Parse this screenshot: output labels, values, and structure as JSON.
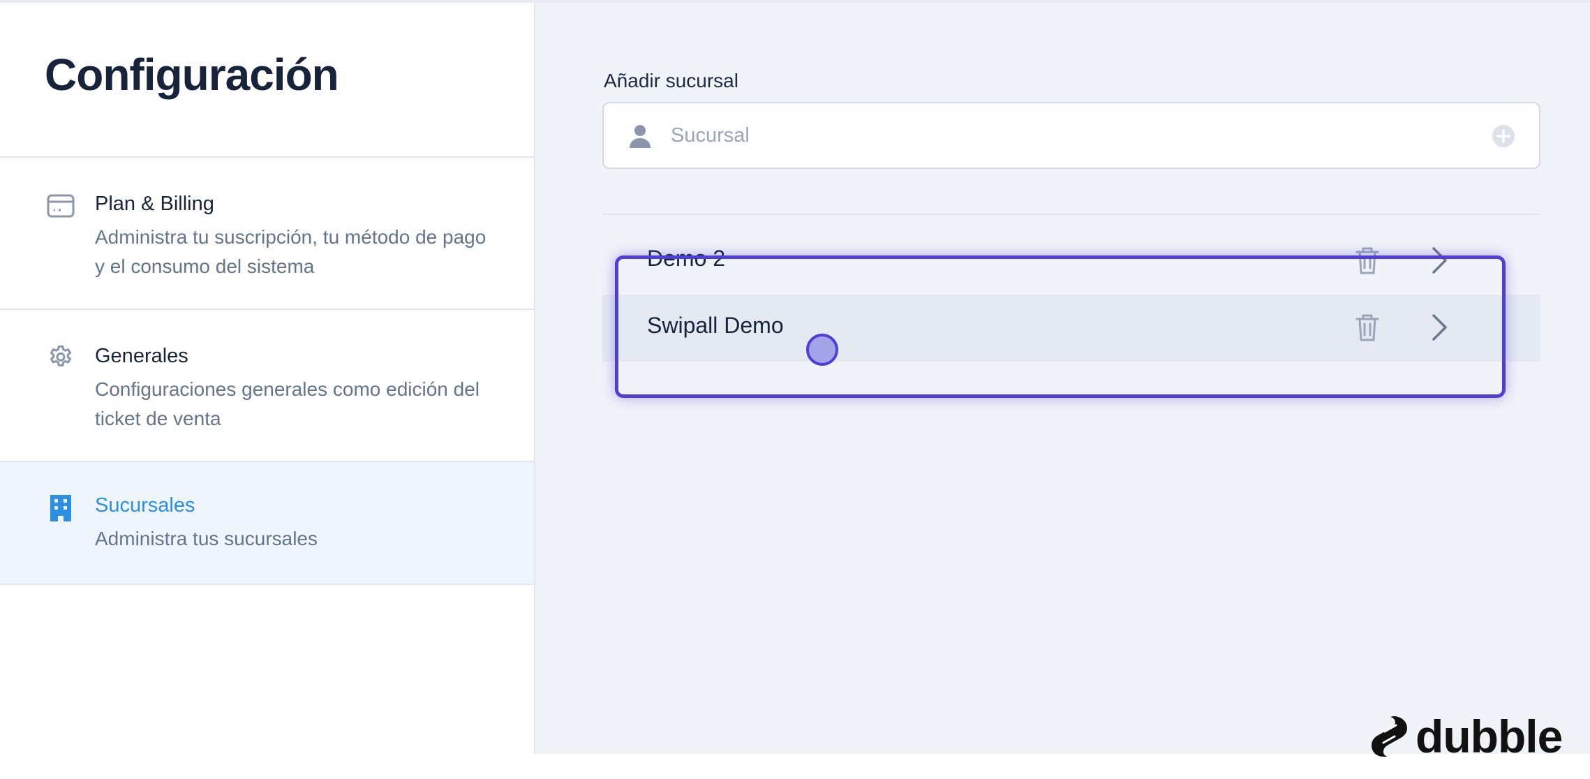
{
  "sidebar": {
    "title": "Configuración",
    "items": [
      {
        "icon": "credit-card-icon",
        "title": "Plan & Billing",
        "description": "Administra tu suscripción, tu método de pago y el consumo del sistema",
        "active": false
      },
      {
        "icon": "gear-icon",
        "title": "Generales",
        "description": "Configuraciones generales como edición del ticket de venta",
        "active": false
      },
      {
        "icon": "building-icon",
        "title": "Sucursales",
        "description": "Administra tus sucursales",
        "active": true
      }
    ]
  },
  "main": {
    "add_branch": {
      "label": "Añadir sucursal",
      "placeholder": "Sucursal",
      "value": ""
    },
    "branches": [
      {
        "name": "Demo 2"
      },
      {
        "name": "Swipall Demo"
      }
    ]
  },
  "brand": {
    "name": "dubble"
  },
  "colors": {
    "accent": "#2d8fe3",
    "active_bg": "#eef5fd",
    "highlight": "#4f3fd3",
    "main_bg": "#f0f3f8"
  }
}
